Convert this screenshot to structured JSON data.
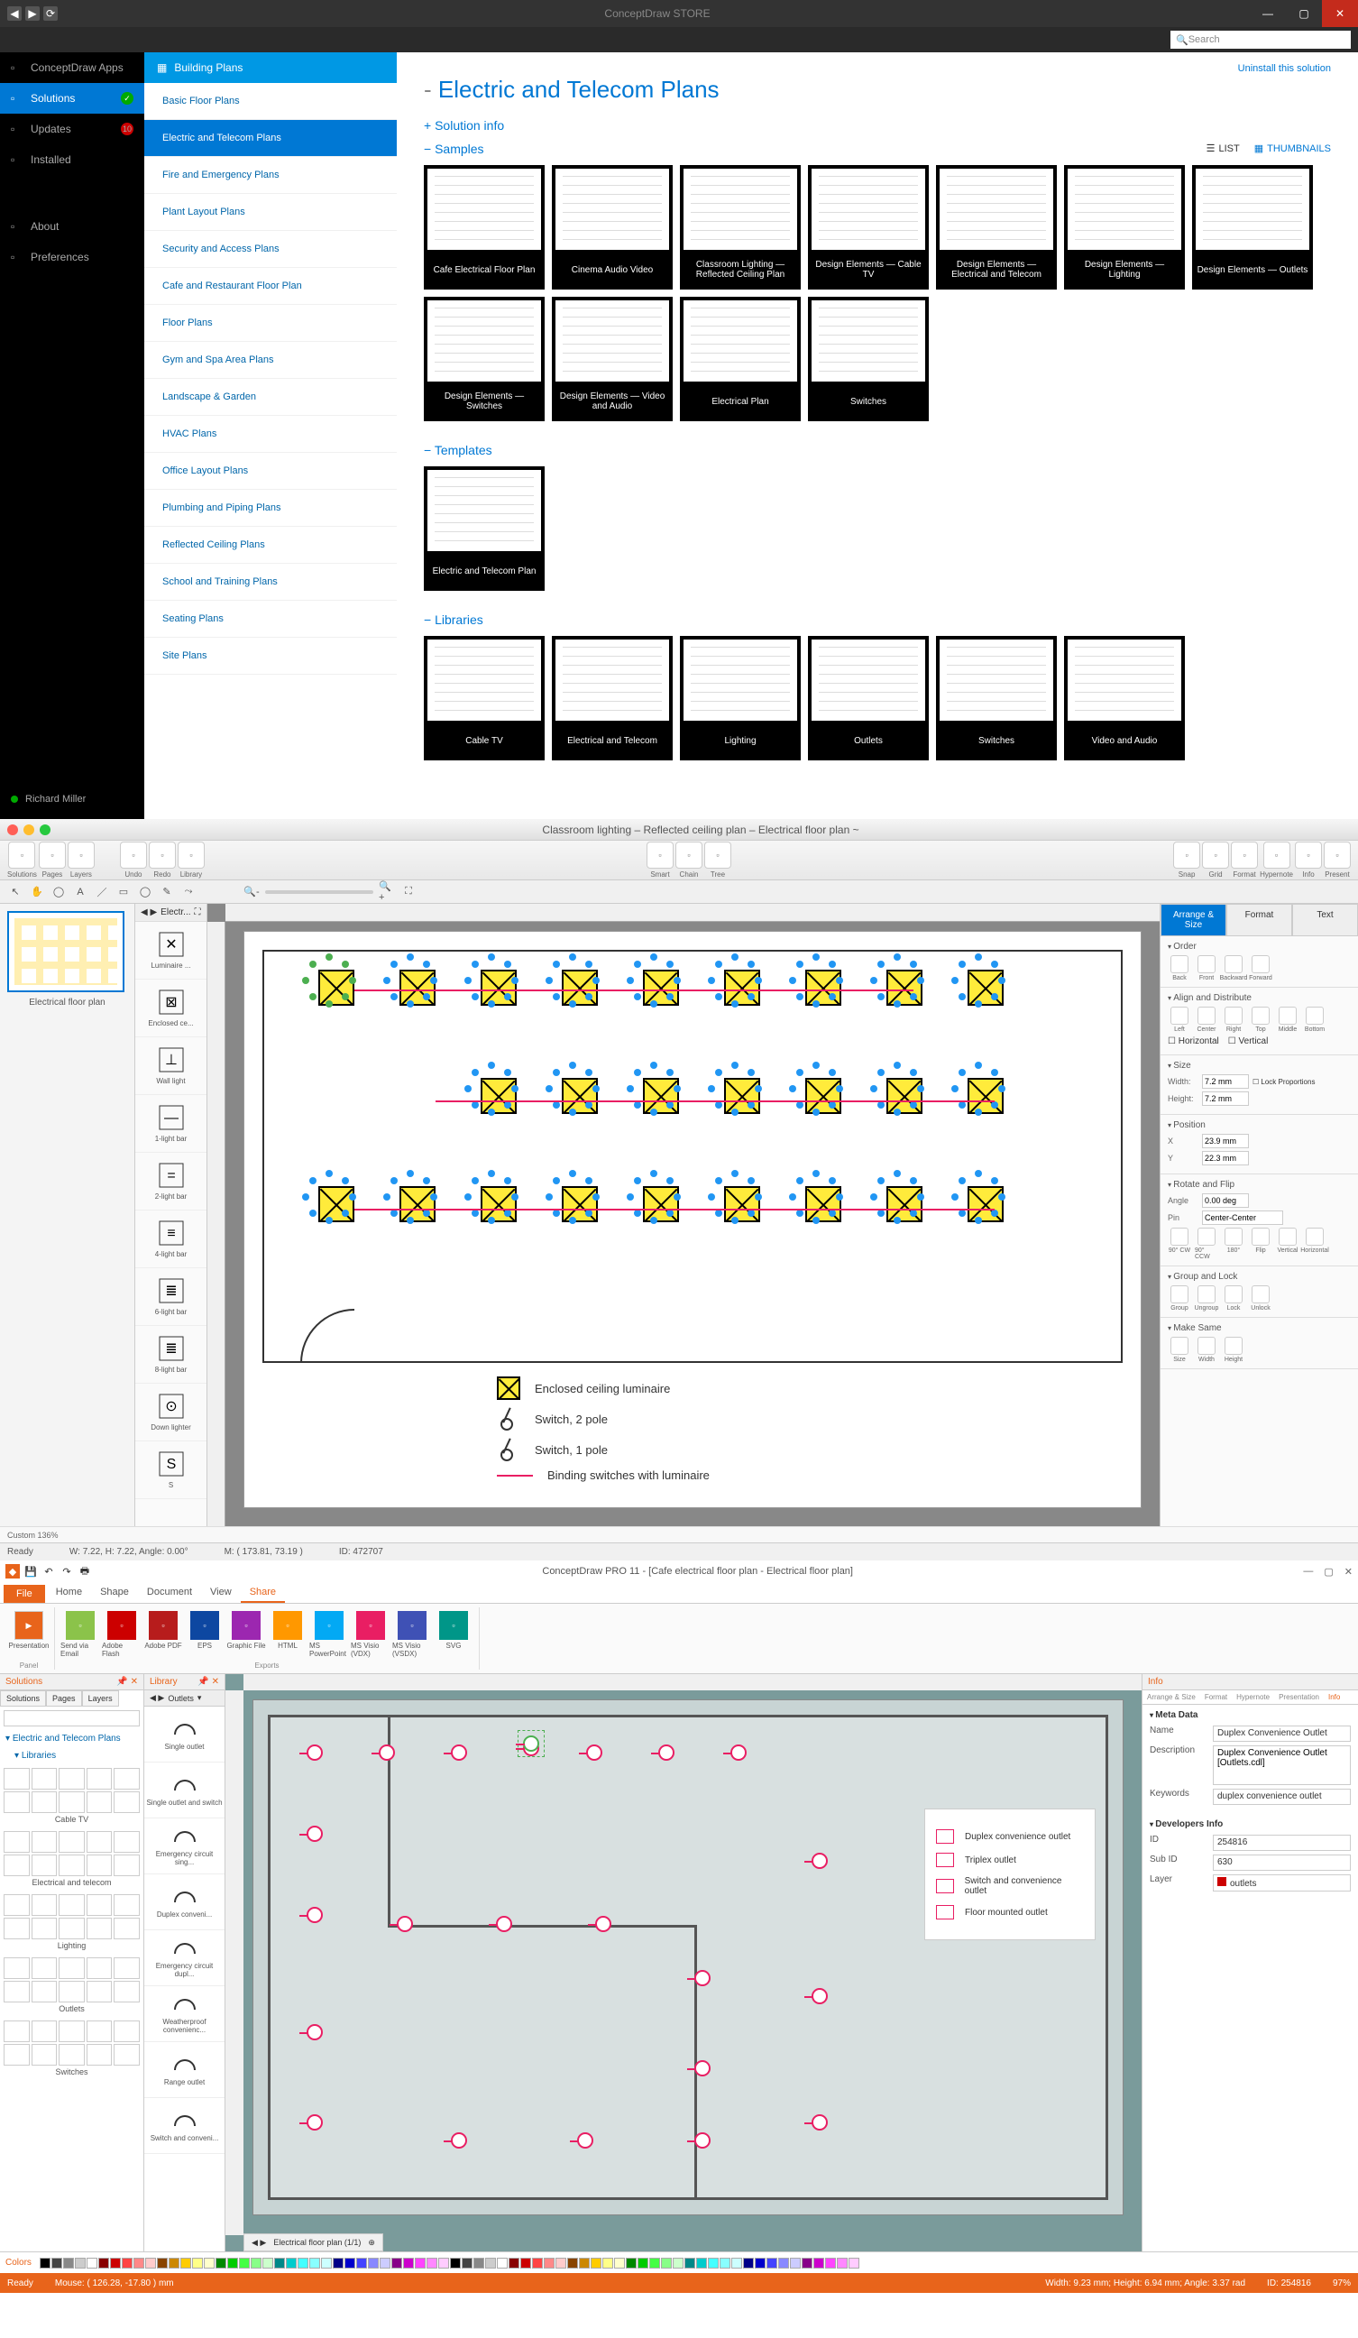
{
  "store": {
    "title": "ConceptDraw STORE",
    "search_placeholder": "Search",
    "uninstall": "Uninstall this solution",
    "leftnav": [
      {
        "label": "ConceptDraw Apps"
      },
      {
        "label": "Solutions",
        "badge": "✓",
        "badge_cls": "badge-green",
        "sel": true
      },
      {
        "label": "Updates",
        "badge": "10",
        "badge_cls": "badge-red"
      },
      {
        "label": "Installed"
      }
    ],
    "leftnav2": [
      {
        "label": "About"
      },
      {
        "label": "Preferences"
      }
    ],
    "user": "Richard Miller",
    "subnav_header": "Building Plans",
    "subnav": [
      "Basic Floor Plans",
      "Electric and Telecom Plans",
      "Fire and Emergency Plans",
      "Plant Layout Plans",
      "Security and Access Plans",
      "Cafe and Restaurant Floor Plan",
      "Floor Plans",
      "Gym and Spa Area Plans",
      "Landscape & Garden",
      "HVAC Plans",
      "Office Layout Plans",
      "Plumbing and Piping Plans",
      "Reflected Ceiling Plans",
      "School and Training Plans",
      "Seating Plans",
      "Site Plans"
    ],
    "subnav_sel": 1,
    "page_title": "Electric and Telecom Plans",
    "view_list": "LIST",
    "view_thumb": "THUMBNAILS",
    "sec_info": "Solution info",
    "sec_samples": "Samples",
    "sec_templates": "Templates",
    "sec_libraries": "Libraries",
    "samples": [
      "Cafe Electrical Floor Plan",
      "Cinema Audio Video",
      "Classroom Lighting — Reflected Ceiling Plan",
      "Design Elements — Cable TV",
      "Design Elements — Electrical and Telecom",
      "Design Elements — Lighting",
      "Design Elements — Outlets",
      "Design Elements — Switches",
      "Design Elements — Video and Audio",
      "Electrical Plan",
      "Switches"
    ],
    "templates": [
      "Electric and Telecom Plan"
    ],
    "libraries": [
      "Cable TV",
      "Electrical and Telecom",
      "Lighting",
      "Outlets",
      "Switches",
      "Video and Audio"
    ]
  },
  "mac": {
    "title": "Classroom lighting – Reflected ceiling plan – Electrical floor plan ~",
    "toolbar_groups_left": [
      "Solutions",
      "Pages",
      "Layers"
    ],
    "toolbar_groups_mid": [
      "Undo",
      "Redo",
      "Library"
    ],
    "toolbar_groups_center": [
      "Smart",
      "Chain",
      "Tree"
    ],
    "toolbar_groups_right": [
      "Snap",
      "Grid",
      "Format",
      "Hypernote",
      "Info",
      "Present"
    ],
    "page_name": "Electrical floor plan",
    "shape_palette_name": "Electr...",
    "shapes": [
      "Luminaire ...",
      "Enclosed ce...",
      "Wall light",
      "1-light bar",
      "2-light bar",
      "4-light bar",
      "6-light bar",
      "8-light bar",
      "Down lighter",
      "S"
    ],
    "legend": {
      "l1": "Enclosed ceiling luminaire",
      "l2": "Switch, 2 pole",
      "l3": "Switch, 1 pole",
      "l4": "Binding switches with luminaire"
    },
    "inspector_tabs": [
      "Arrange & Size",
      "Format",
      "Text"
    ],
    "insp": {
      "order": "Order",
      "order_btns": [
        "Back",
        "Front",
        "Backward",
        "Forward"
      ],
      "align": "Align and Distribute",
      "align_btns": [
        "Left",
        "Center",
        "Right",
        "Top",
        "Middle",
        "Bottom"
      ],
      "align_h": "Horizontal",
      "align_v": "Vertical",
      "size": "Size",
      "width_l": "Width:",
      "width_v": "7.2 mm",
      "height_l": "Height:",
      "height_v": "7.2 mm",
      "lock_prop": "Lock Proportions",
      "pos": "Position",
      "x_l": "X",
      "x_v": "23.9 mm",
      "y_l": "Y",
      "y_v": "22.3 mm",
      "rotate": "Rotate and Flip",
      "angle_l": "Angle",
      "angle_v": "0.00 deg",
      "pin_l": "Pin",
      "pin_v": "Center-Center",
      "rot_btns": [
        "90° CW",
        "90° CCW",
        "180°",
        "Flip",
        "Vertical",
        "Horizontal"
      ],
      "group": "Group and Lock",
      "group_btns": [
        "Group",
        "Ungroup",
        "Lock",
        "Unlock"
      ],
      "same": "Make Same",
      "same_btns": [
        "Size",
        "Width",
        "Height"
      ]
    },
    "zoom": "Custom 136%",
    "status": {
      "ready": "Ready",
      "wh": "W: 7.22, H: 7.22, Angle: 0.00°",
      "m": "M: ( 173.81, 73.19 )",
      "id": "ID: 472707"
    }
  },
  "win": {
    "title": "ConceptDraw PRO 11 - [Cafe electrical floor plan - Electrical floor plan]",
    "file": "File",
    "ribbon_tabs": [
      "Home",
      "Shape",
      "Document",
      "View",
      "Share"
    ],
    "ribbon_sel": 4,
    "export_btns": [
      "Presentation",
      "Send via Email",
      "Adobe Flash",
      "Adobe PDF",
      "EPS",
      "Graphic File",
      "HTML",
      "MS PowerPoint",
      "MS Visio (VDX)",
      "MS Visio (VSDX)",
      "SVG"
    ],
    "export_grp1": "Panel",
    "export_grp2": "Exports",
    "sol_title": "Solutions",
    "sol_tabs": [
      "Solutions",
      "Pages",
      "Layers"
    ],
    "sol_tree": "Electric and Telecom Plans",
    "sol_tree2": "Libraries",
    "sol_libs": [
      "Cable TV",
      "Electrical and telecom",
      "Lighting",
      "Outlets",
      "Switches"
    ],
    "lib_title": "Library",
    "lib_tab": "Outlets",
    "lib_items": [
      "Single outlet",
      "Single outlet and switch",
      "Emergency circuit sing...",
      "Duplex conveni...",
      "Emergency circuit dupl...",
      "Weatherproof convenienc...",
      "Range outlet",
      "Switch and conveni..."
    ],
    "canvas_legend": [
      "Duplex convenience outlet",
      "Triplex outlet",
      "Switch and convenience outlet",
      "Floor mounted outlet"
    ],
    "page_tab": "Electrical floor plan (1/1)",
    "info_title": "Info",
    "info_tabs": [
      "Arrange & Size",
      "Format",
      "Hypernote",
      "Presentation",
      "Info"
    ],
    "meta_h": "Meta Data",
    "name_l": "Name",
    "name_v": "Duplex Convenience Outlet",
    "desc_l": "Description",
    "desc_v": "Duplex Convenience Outlet [Outlets.cdl]",
    "keyw_l": "Keywords",
    "keyw_v": "duplex convenience outlet",
    "dev_h": "Developers Info",
    "id_l": "ID",
    "id_v": "254816",
    "sub_l": "Sub ID",
    "sub_v": "630",
    "layer_l": "Layer",
    "layer_v": "outlets",
    "colors_title": "Colors",
    "status": {
      "ready": "Ready",
      "mouse": "Mouse: ( 126.28, -17.80 ) mm",
      "size": "Width: 9.23 mm;  Height: 6.94 mm;  Angle: 3.37 rad",
      "id": "ID: 254816",
      "zoom": "97%"
    }
  }
}
